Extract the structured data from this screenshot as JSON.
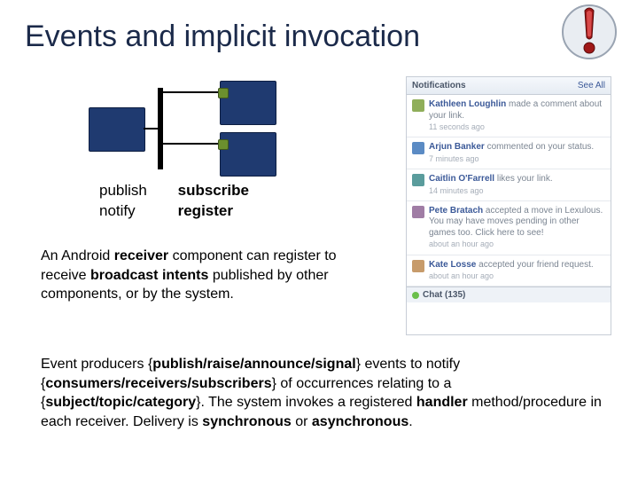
{
  "title": "Events and implicit invocation",
  "icons": {
    "attention": "attention-icon"
  },
  "diagram": {
    "left_label_1": "publish",
    "left_label_2": "notify",
    "right_label_1": "subscribe",
    "right_label_2": "register"
  },
  "para_android": {
    "pre1": "An Android ",
    "b1": "receiver",
    "mid1": " component can register to receive ",
    "b2": "broadcast intents",
    "post1": " published by other components, or by the system."
  },
  "para_main": {
    "t1": "Event producers {",
    "b1": "publish/raise/announce/signal",
    "t2": "} events to notify {",
    "b2": "consumers/receivers/subscribers",
    "t3": "} of occurrences relating to a {",
    "b3": "subject/topic/category",
    "t4": "}.  The system invokes a registered ",
    "b4": "handler",
    "t5": " method/procedure in each receiver.  Delivery is ",
    "b5": "synchronous",
    "t6": " or ",
    "b6": "asynchronous",
    "t7": "."
  },
  "panel": {
    "title": "Notifications",
    "see_all": "See All",
    "items": [
      {
        "name": "Kathleen Loughlin",
        "text": " made a comment about your link.",
        "time": "11 seconds ago"
      },
      {
        "name": "Arjun Banker",
        "text": " commented on your status.",
        "time": "7 minutes ago"
      },
      {
        "name": "Caitlin O'Farrell",
        "text": " likes your link.",
        "time": "14 minutes ago"
      },
      {
        "name": "Pete Bratach",
        "text": " accepted a move in Lexulous. You may have moves pending in other games too. Click here to see!",
        "time": "about an hour ago"
      },
      {
        "name": "Kate Losse",
        "text": " accepted your friend request.",
        "time": "about an hour ago"
      }
    ],
    "chat_label": "Chat (135)"
  }
}
